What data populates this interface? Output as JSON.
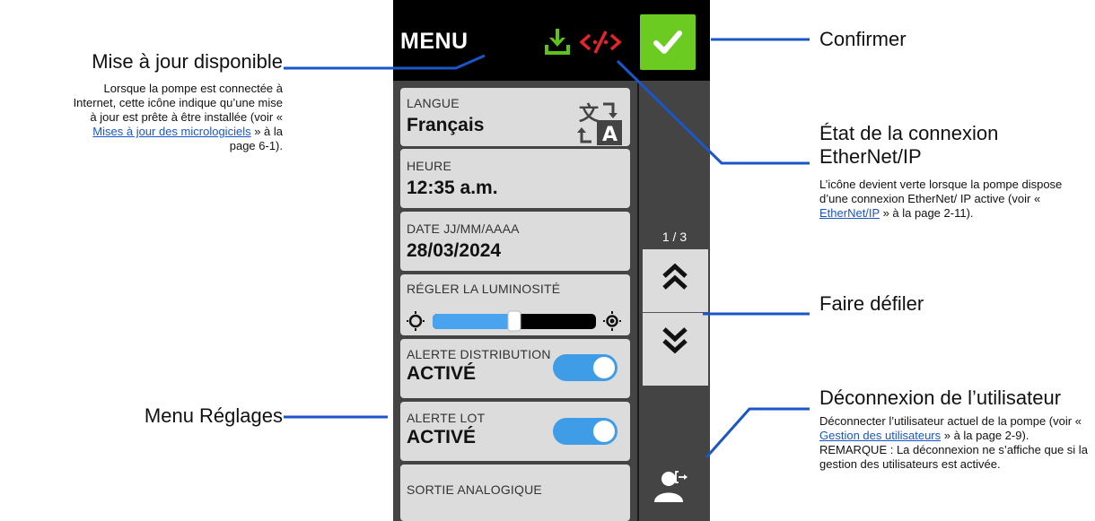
{
  "screen": {
    "menu_title": "MENU",
    "confirm_icon": "check-icon",
    "update_icon": "download-icon",
    "connection_icon": "network-disconnected-icon",
    "colors": {
      "topbar": "#000000",
      "confirm": "#6ccb21",
      "update_icon": "#5fc21b",
      "connection_icon": "#e8232a",
      "toggle_on": "#3f9ce6",
      "slider_fill": "#4aa3ee",
      "card": "#dcdcdc",
      "panel": "#444444"
    },
    "settings": [
      {
        "label": "LANGUE",
        "value": "Français",
        "icon": "translate-icon"
      },
      {
        "label": "HEURE",
        "value": "12:35 a.m."
      },
      {
        "label": "DATE JJ/MM/AAAA",
        "value": "28/03/2024"
      },
      {
        "label": "RÉGLER LA LUMINOSITÉ",
        "brightness_fraction": 0.5
      },
      {
        "label": "ALERTE DISTRIBUTION",
        "value": "ACTIVÉ",
        "toggle_on": true
      },
      {
        "label": "ALERTE LOT",
        "value": "ACTIVÉ",
        "toggle_on": true
      },
      {
        "label": "SORTIE ANALOGIQUE"
      }
    ],
    "page_indicator": "1 / 3",
    "scroll_up_icon": "double-chevron-up-icon",
    "scroll_down_icon": "double-chevron-down-icon",
    "logout_icon": "user-logout-icon"
  },
  "callouts": {
    "update": {
      "title": "Mise à jour disponible",
      "body_before": "Lorsque la pompe est connectée à Internet, cette icône indique qu’une mise à jour est prête à être installée (voir « ",
      "link": "Mises à jour des micrologiciels",
      "body_after": " » à la page 6-1)."
    },
    "settings_menu": {
      "title": "Menu Réglages"
    },
    "confirm": {
      "title": "Confirmer"
    },
    "connection": {
      "title_line1": "État de la connexion",
      "title_line2": "EtherNet/IP",
      "body_before": "L’icône devient verte lorsque la pompe dispose d’une connexion EtherNet/ IP active (voir « ",
      "link": "EtherNet/IP",
      "body_after": " » à la page 2-11)."
    },
    "scroll": {
      "title": "Faire défiler"
    },
    "logout": {
      "title": "Déconnexion de l’utilisateur",
      "body_before": "Déconnecter l’utilisateur actuel de la pompe (voir « ",
      "link": "Gestion des utilisateurs",
      "body_after": " » à la page 2-9). REMARQUE : La déconnexion ne s’affiche que si la gestion des utilisateurs est activée."
    }
  }
}
